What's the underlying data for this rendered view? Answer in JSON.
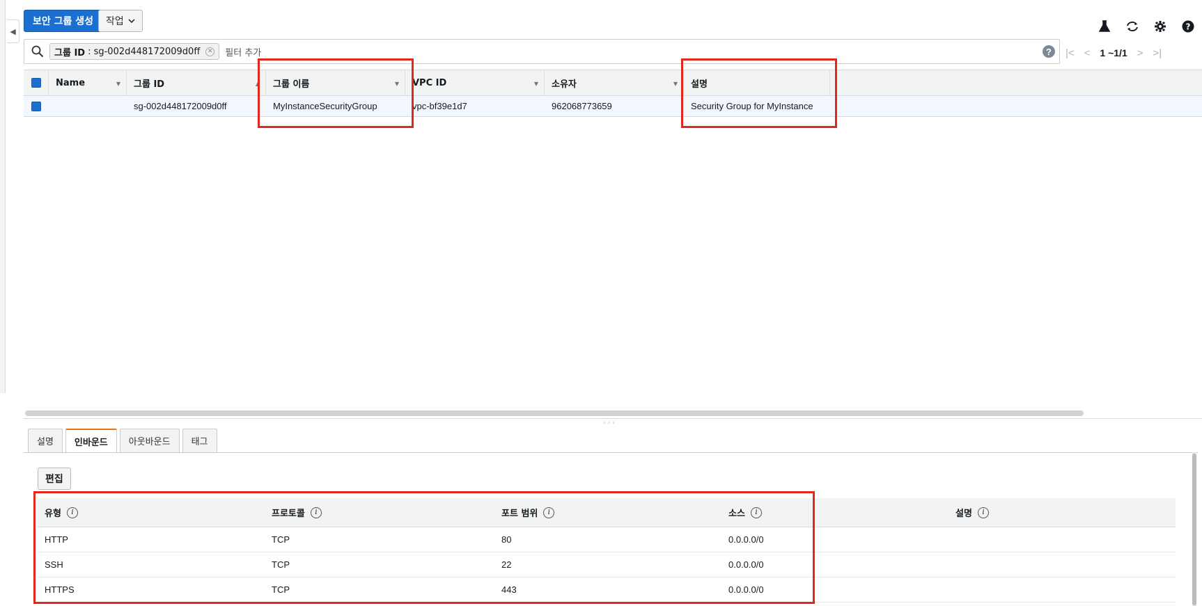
{
  "toolbar": {
    "create_label": "보안 그룹 생성",
    "actions_label": "작업",
    "icons": [
      "flask-icon",
      "refresh-icon",
      "gear-icon",
      "help-icon"
    ]
  },
  "search": {
    "chip_key": "그룹 ID",
    "chip_value": ": sg-002d448172009d0ff",
    "add_filter": "필터 추가"
  },
  "pager": {
    "text": "1 ~1/1"
  },
  "grid": {
    "columns": [
      "Name",
      "그룹 ID",
      "그룹 이름",
      "VPC ID",
      "소유자",
      "설명"
    ],
    "rows": [
      {
        "name": "",
        "group_id": "sg-002d448172009d0ff",
        "group_name": "MyInstanceSecurityGroup",
        "vpc_id": "vpc-bf39e1d7",
        "owner": "962068773659",
        "description": "Security Group for MyInstance"
      }
    ]
  },
  "tabs": [
    "설명",
    "인바운드",
    "아웃바운드",
    "태그"
  ],
  "active_tab": "인바운드",
  "edit_label": "편집",
  "rules": {
    "columns": [
      "유형",
      "프로토콜",
      "포트 범위",
      "소스",
      "설명"
    ],
    "rows": [
      {
        "type": "HTTP",
        "protocol": "TCP",
        "port": "80",
        "source": "0.0.0.0/0",
        "description": ""
      },
      {
        "type": "SSH",
        "protocol": "TCP",
        "port": "22",
        "source": "0.0.0.0/0",
        "description": ""
      },
      {
        "type": "HTTPS",
        "protocol": "TCP",
        "port": "443",
        "source": "0.0.0.0/0",
        "description": ""
      }
    ]
  },
  "colors": {
    "accent": "#1b6fd1",
    "highlight": "#e0281c",
    "tab_accent": "#ec7211"
  }
}
